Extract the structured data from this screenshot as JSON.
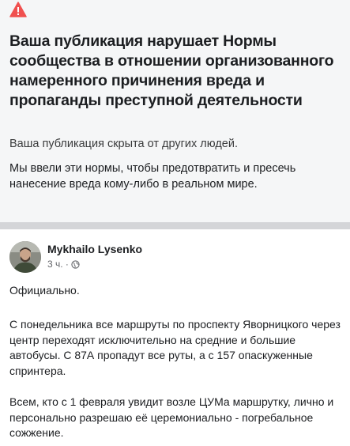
{
  "notice": {
    "icon": "warning-triangle-icon",
    "accent_color": "#f0504f",
    "title": "Ваша публикация нарушает Нормы сообщества в отношении организованного намеренного причинения вреда и пропаганды преступной деятельности",
    "subtitle": "Ваша публикация скрыта от других людей.",
    "body": "Мы ввели эти нормы, чтобы предотвратить и пресечь нанесение вреда кому-либо в реальном мире."
  },
  "post": {
    "author": "Mykhailo Lysenko",
    "time": "3 ч. ·",
    "audience_icon": "globe-icon",
    "paragraphs": [
      "Официально.",
      "С понедельника все маршруты по проспекту Яворницкого через центр переходят исключительно на средние и большие автобусы. С 87А пропадут все руты, а с 157 опаскуженные спринтера.",
      "Всем, кто с 1 февраля увидит возле ЦУМа маршрутку, лично и персонально разрешаю её церемониально - погребальное сожжение."
    ]
  }
}
